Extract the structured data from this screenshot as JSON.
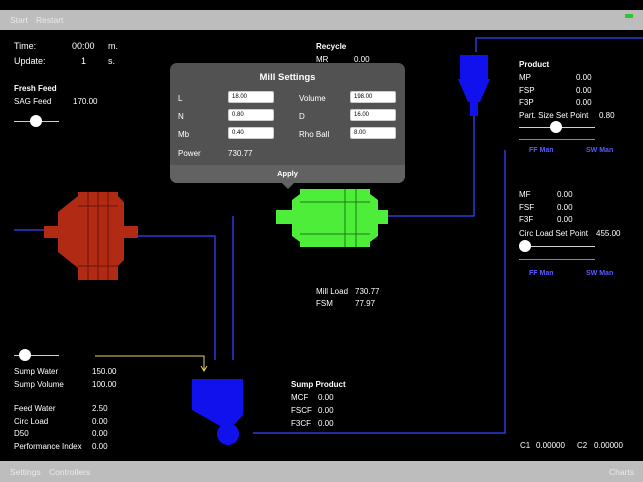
{
  "toolbar": {
    "start": "Start",
    "restart": "Restart"
  },
  "time": {
    "label": "Time:",
    "value": "00:00",
    "unit": "m."
  },
  "update": {
    "label": "Update:",
    "value": "1",
    "unit": "s."
  },
  "fresh_feed": {
    "title": "Fresh Feed",
    "sag_label": "SAG  Feed",
    "sag_value": "170.00"
  },
  "recycle": {
    "title": "Recycle",
    "mr_label": "MR",
    "mr_value": "0.00"
  },
  "modal": {
    "title": "Mill Settings",
    "fields": {
      "L": {
        "label": "L",
        "value": "18.00"
      },
      "N": {
        "label": "N",
        "value": "0.80"
      },
      "Mb": {
        "label": "Mb",
        "value": "0.40"
      },
      "Volume": {
        "label": "Volume",
        "value": "198.00"
      },
      "D": {
        "label": "D",
        "value": "16.00"
      },
      "RhoBall": {
        "label": "Rho Ball",
        "value": "8.00"
      }
    },
    "power_label": "Power",
    "power_value": "730.77",
    "apply": "Apply"
  },
  "product": {
    "title": "Product",
    "mp_label": "MP",
    "mp_value": "0.00",
    "fsp_label": "FSP",
    "fsp_value": "0.00",
    "f3p_label": "F3P",
    "f3p_value": "0.00",
    "setpoint_label": "Part. Size Set Point",
    "setpoint_value": "0.80",
    "ff_man": "FF Man",
    "sw_man": "SW Man"
  },
  "circ": {
    "mf_label": "MF",
    "mf_value": "0.00",
    "fsf_label": "FSF",
    "fsf_value": "0.00",
    "f3f_label": "F3F",
    "f3f_value": "0.00",
    "setpoint_label": "Circ Load Set Point",
    "setpoint_value": "455.00",
    "ff_man": "FF Man",
    "sw_man": "SW Man"
  },
  "mill": {
    "load_label": "Mill Load",
    "load_value": "730.77",
    "fsm_label": "FSM",
    "fsm_value": "77.97"
  },
  "sump_left": {
    "water_label": "Sump Water",
    "water_value": "150.00",
    "volume_label": "Sump Volume",
    "volume_value": "100.00"
  },
  "stats": {
    "feed_water_label": "Feed Water",
    "feed_water_value": "2.50",
    "circ_load_label": "Circ Load",
    "circ_load_value": "0.00",
    "d50_label": "D50",
    "d50_value": "0.00",
    "perf_label": "Performance Index",
    "perf_value": "0.00"
  },
  "sump_product": {
    "title": "Sump Product",
    "mcf_label": "MCF",
    "mcf_value": "0.00",
    "fscf_label": "FSCF",
    "fscf_value": "0.00",
    "f3cf_label": "F3CF",
    "f3cf_value": "0.00"
  },
  "controllers_readout": {
    "c1_label": "C1",
    "c1_value": "0.00000",
    "c2_label": "C2",
    "c2_value": "0.00000"
  },
  "bottom_bar": {
    "settings": "Settings",
    "controllers": "Controllers",
    "charts": "Charts"
  },
  "colors": {
    "sag_mill": "#b02a14",
    "ball_mill": "#4ded3a",
    "cyclone": "#1111ee",
    "pipe": "#2a3bd6",
    "accent_link": "#5a5aff"
  }
}
